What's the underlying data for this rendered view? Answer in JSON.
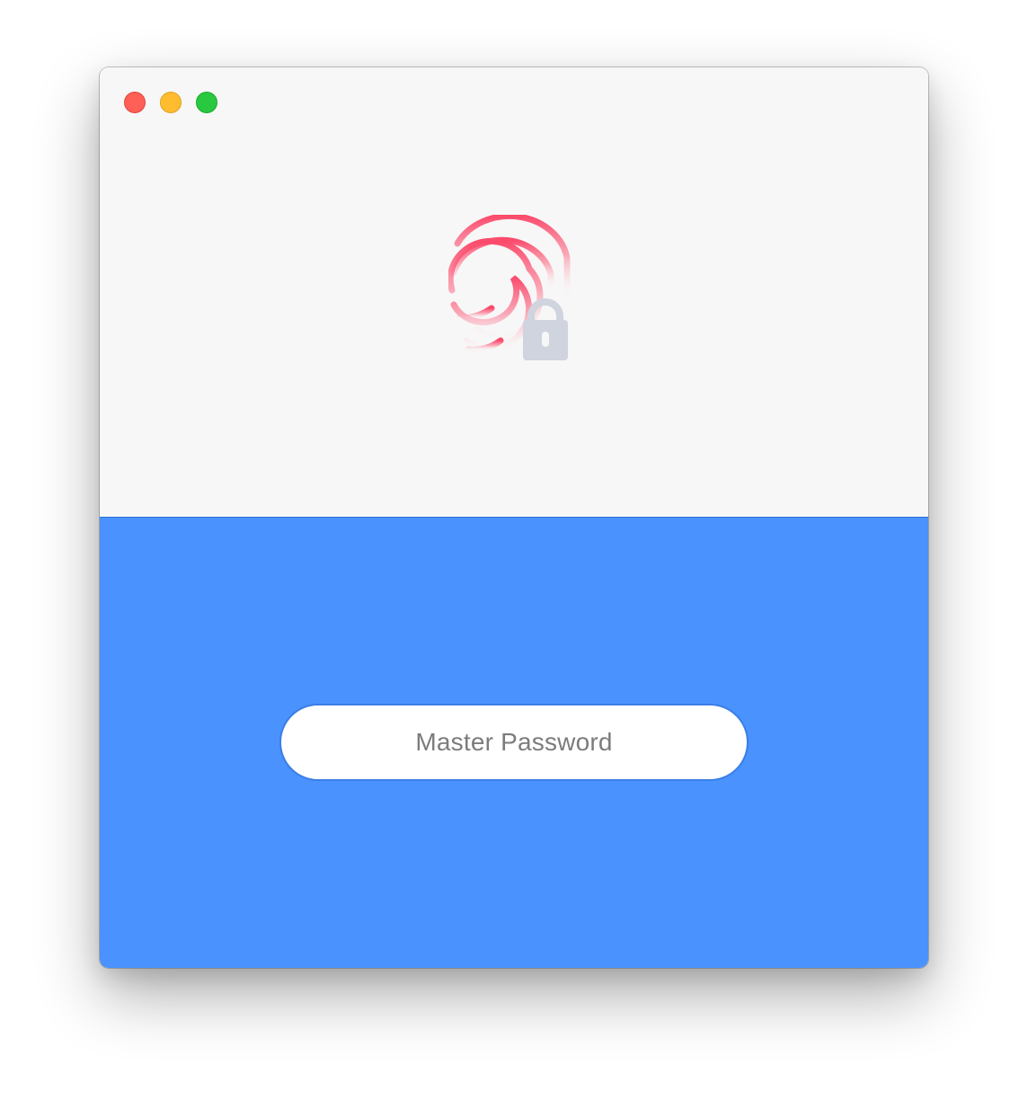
{
  "window": {
    "controls": {
      "close_icon": "traffic-light-close",
      "minimize_icon": "traffic-light-minimize",
      "zoom_icon": "traffic-light-zoom"
    }
  },
  "top_pane": {
    "icon": "fingerprint-lock-icon",
    "colors": {
      "fingerprint": "#fb4b6c",
      "lock": "#cfd4de",
      "background": "#f7f7f7"
    }
  },
  "bottom_pane": {
    "background": "#4a92fe",
    "password_field": {
      "placeholder": "Master Password",
      "value": ""
    }
  }
}
